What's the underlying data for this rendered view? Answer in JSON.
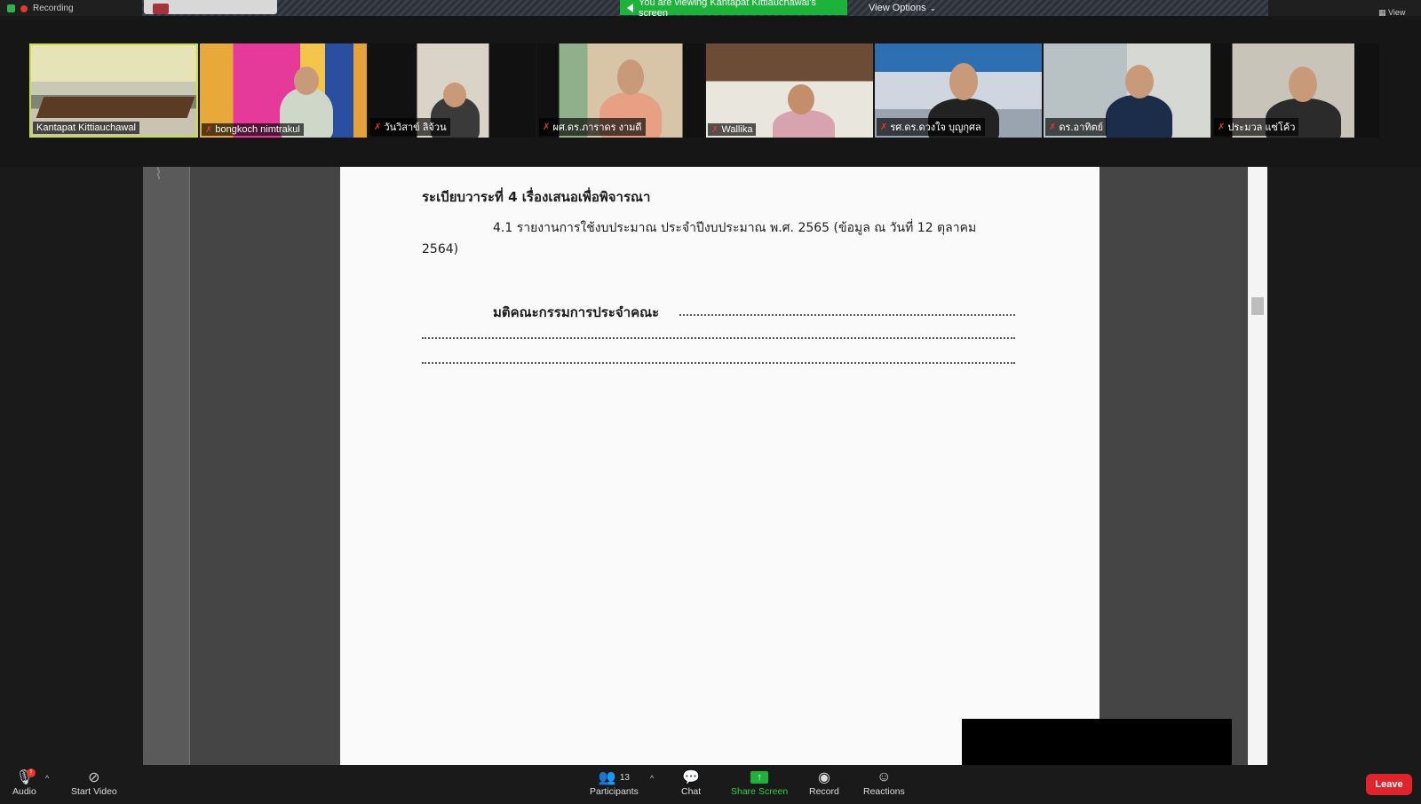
{
  "top_bar": {
    "recording_label": "Recording",
    "viewing_banner": "You are viewing Kantapat Kittiauchawal's screen",
    "view_options_label": "View Options",
    "view_label": "View"
  },
  "participants_strip": [
    {
      "name": "Kantapat Kittiauchawal",
      "muted": false,
      "active": true
    },
    {
      "name": "bongkoch nimtrakul",
      "muted": true,
      "active": false
    },
    {
      "name": "วันวิสาข์ ลิจ้วน",
      "muted": true,
      "active": false
    },
    {
      "name": "ผศ.ดร.ภาราดร งามดี",
      "muted": true,
      "active": false
    },
    {
      "name": "Wallika",
      "muted": true,
      "active": false
    },
    {
      "name": "รศ.ดร.ดวงใจ บุญกุศล",
      "muted": true,
      "active": false
    },
    {
      "name": "ดร.อาทิตย์",
      "muted": true,
      "active": false
    },
    {
      "name": "ประมวล แซ่โค้ว",
      "muted": true,
      "active": false
    }
  ],
  "document": {
    "agenda_heading": "ระเบียบวาระที่ 4  เรื่องเสนอเพื่อพิจารณา",
    "item_4_1_line1": "4.1  รายงานการใช้งบประมาณ ประจำปีงบประมาณ พ.ศ. 2565 (ข้อมูล ณ วันที่ 12 ตุลาคม",
    "item_4_1_line2": "2564)",
    "resolution_label": "มติคณะกรรมการประจำคณะ"
  },
  "toolbar": {
    "audio_label": "Audio",
    "audio_badge": "!",
    "start_video_label": "Start Video",
    "participants_label": "Participants",
    "participants_count": "13",
    "chat_label": "Chat",
    "share_screen_label": "Share Screen",
    "record_label": "Record",
    "reactions_label": "Reactions",
    "leave_label": "Leave"
  },
  "colors": {
    "active_speaker_border": "#c8e23a",
    "share_green": "#1db33b",
    "leave_red": "#e0242c",
    "muted_red": "#e2382f"
  }
}
